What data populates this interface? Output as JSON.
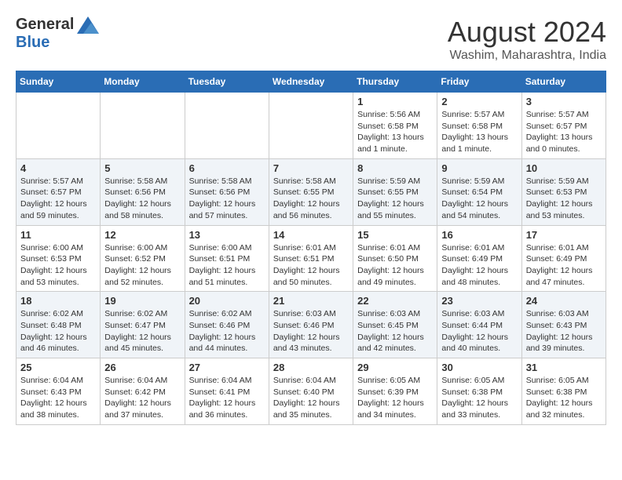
{
  "header": {
    "logo_general": "General",
    "logo_blue": "Blue",
    "month_title": "August 2024",
    "location": "Washim, Maharashtra, India"
  },
  "calendar": {
    "days_of_week": [
      "Sunday",
      "Monday",
      "Tuesday",
      "Wednesday",
      "Thursday",
      "Friday",
      "Saturday"
    ],
    "weeks": [
      [
        {
          "day": "",
          "info": ""
        },
        {
          "day": "",
          "info": ""
        },
        {
          "day": "",
          "info": ""
        },
        {
          "day": "",
          "info": ""
        },
        {
          "day": "1",
          "info": "Sunrise: 5:56 AM\nSunset: 6:58 PM\nDaylight: 13 hours\nand 1 minute."
        },
        {
          "day": "2",
          "info": "Sunrise: 5:57 AM\nSunset: 6:58 PM\nDaylight: 13 hours\nand 1 minute."
        },
        {
          "day": "3",
          "info": "Sunrise: 5:57 AM\nSunset: 6:57 PM\nDaylight: 13 hours\nand 0 minutes."
        }
      ],
      [
        {
          "day": "4",
          "info": "Sunrise: 5:57 AM\nSunset: 6:57 PM\nDaylight: 12 hours\nand 59 minutes."
        },
        {
          "day": "5",
          "info": "Sunrise: 5:58 AM\nSunset: 6:56 PM\nDaylight: 12 hours\nand 58 minutes."
        },
        {
          "day": "6",
          "info": "Sunrise: 5:58 AM\nSunset: 6:56 PM\nDaylight: 12 hours\nand 57 minutes."
        },
        {
          "day": "7",
          "info": "Sunrise: 5:58 AM\nSunset: 6:55 PM\nDaylight: 12 hours\nand 56 minutes."
        },
        {
          "day": "8",
          "info": "Sunrise: 5:59 AM\nSunset: 6:55 PM\nDaylight: 12 hours\nand 55 minutes."
        },
        {
          "day": "9",
          "info": "Sunrise: 5:59 AM\nSunset: 6:54 PM\nDaylight: 12 hours\nand 54 minutes."
        },
        {
          "day": "10",
          "info": "Sunrise: 5:59 AM\nSunset: 6:53 PM\nDaylight: 12 hours\nand 53 minutes."
        }
      ],
      [
        {
          "day": "11",
          "info": "Sunrise: 6:00 AM\nSunset: 6:53 PM\nDaylight: 12 hours\nand 53 minutes."
        },
        {
          "day": "12",
          "info": "Sunrise: 6:00 AM\nSunset: 6:52 PM\nDaylight: 12 hours\nand 52 minutes."
        },
        {
          "day": "13",
          "info": "Sunrise: 6:00 AM\nSunset: 6:51 PM\nDaylight: 12 hours\nand 51 minutes."
        },
        {
          "day": "14",
          "info": "Sunrise: 6:01 AM\nSunset: 6:51 PM\nDaylight: 12 hours\nand 50 minutes."
        },
        {
          "day": "15",
          "info": "Sunrise: 6:01 AM\nSunset: 6:50 PM\nDaylight: 12 hours\nand 49 minutes."
        },
        {
          "day": "16",
          "info": "Sunrise: 6:01 AM\nSunset: 6:49 PM\nDaylight: 12 hours\nand 48 minutes."
        },
        {
          "day": "17",
          "info": "Sunrise: 6:01 AM\nSunset: 6:49 PM\nDaylight: 12 hours\nand 47 minutes."
        }
      ],
      [
        {
          "day": "18",
          "info": "Sunrise: 6:02 AM\nSunset: 6:48 PM\nDaylight: 12 hours\nand 46 minutes."
        },
        {
          "day": "19",
          "info": "Sunrise: 6:02 AM\nSunset: 6:47 PM\nDaylight: 12 hours\nand 45 minutes."
        },
        {
          "day": "20",
          "info": "Sunrise: 6:02 AM\nSunset: 6:46 PM\nDaylight: 12 hours\nand 44 minutes."
        },
        {
          "day": "21",
          "info": "Sunrise: 6:03 AM\nSunset: 6:46 PM\nDaylight: 12 hours\nand 43 minutes."
        },
        {
          "day": "22",
          "info": "Sunrise: 6:03 AM\nSunset: 6:45 PM\nDaylight: 12 hours\nand 42 minutes."
        },
        {
          "day": "23",
          "info": "Sunrise: 6:03 AM\nSunset: 6:44 PM\nDaylight: 12 hours\nand 40 minutes."
        },
        {
          "day": "24",
          "info": "Sunrise: 6:03 AM\nSunset: 6:43 PM\nDaylight: 12 hours\nand 39 minutes."
        }
      ],
      [
        {
          "day": "25",
          "info": "Sunrise: 6:04 AM\nSunset: 6:43 PM\nDaylight: 12 hours\nand 38 minutes."
        },
        {
          "day": "26",
          "info": "Sunrise: 6:04 AM\nSunset: 6:42 PM\nDaylight: 12 hours\nand 37 minutes."
        },
        {
          "day": "27",
          "info": "Sunrise: 6:04 AM\nSunset: 6:41 PM\nDaylight: 12 hours\nand 36 minutes."
        },
        {
          "day": "28",
          "info": "Sunrise: 6:04 AM\nSunset: 6:40 PM\nDaylight: 12 hours\nand 35 minutes."
        },
        {
          "day": "29",
          "info": "Sunrise: 6:05 AM\nSunset: 6:39 PM\nDaylight: 12 hours\nand 34 minutes."
        },
        {
          "day": "30",
          "info": "Sunrise: 6:05 AM\nSunset: 6:38 PM\nDaylight: 12 hours\nand 33 minutes."
        },
        {
          "day": "31",
          "info": "Sunrise: 6:05 AM\nSunset: 6:38 PM\nDaylight: 12 hours\nand 32 minutes."
        }
      ]
    ]
  }
}
